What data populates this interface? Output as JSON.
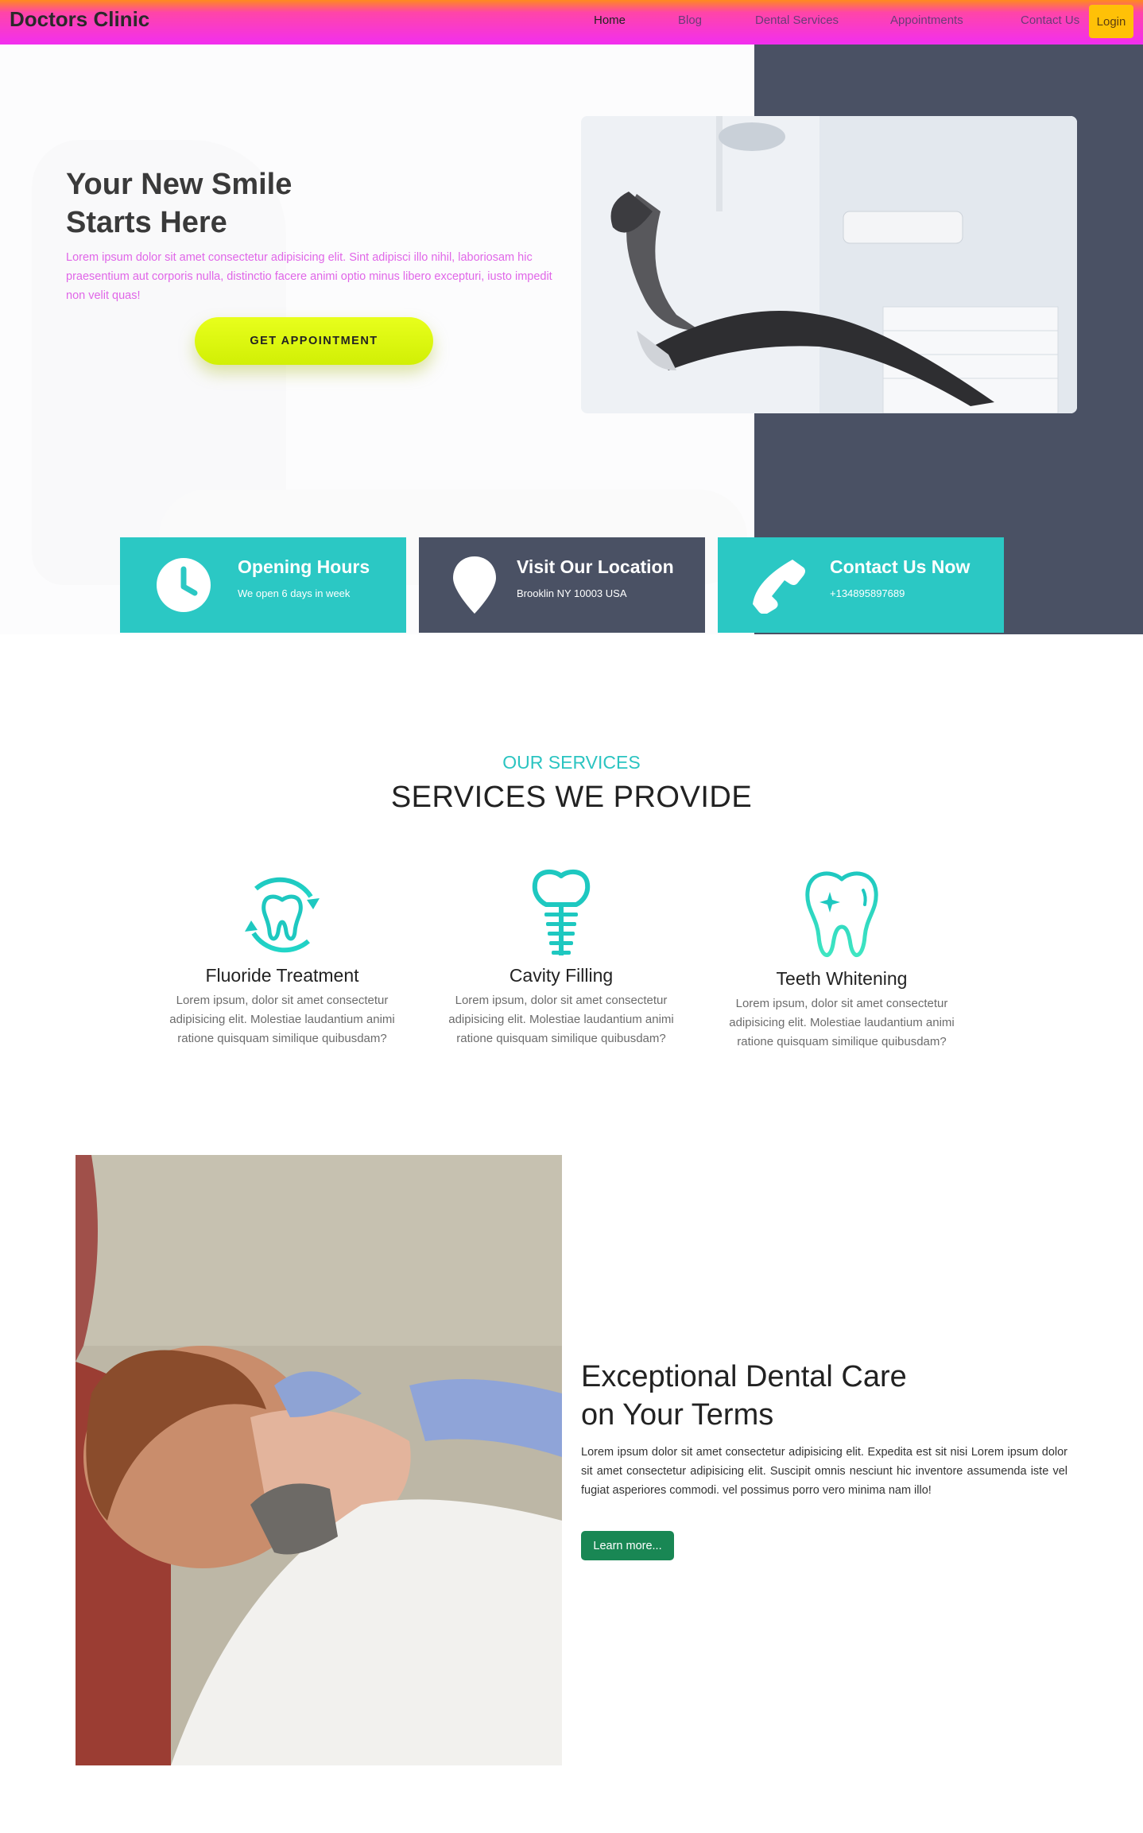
{
  "navbar": {
    "brand": "Doctors Clinic",
    "links": [
      "Home",
      "Blog",
      "Dental Services",
      "Appointments",
      "Contact Us"
    ],
    "login": "Login"
  },
  "hero": {
    "title": "Your New Smile\nStarts Here",
    "text": "Lorem ipsum dolor sit amet consectetur adipisicing elit. Sint adipisci illo nihil, laboriosam hic praesentium aut corporis nulla, distinctio facere animi optio minus libero excepturi, iusto impedit non velit quas!",
    "button": "GET APPOINTMENT"
  },
  "cards": [
    {
      "title": "Opening Hours",
      "text": "We open 6 days in week",
      "icon": "clock-icon",
      "color": "#2bc8c4"
    },
    {
      "title": "Visit Our Location",
      "text": "Brooklin NY 10003 USA",
      "icon": "location-pin-icon",
      "color": "#4a5164"
    },
    {
      "title": "Contact Us Now",
      "text": "+134895897689",
      "icon": "phone-icon",
      "color": "#2bc8c4"
    }
  ],
  "services": {
    "eyebrow": "OUR SERVICES",
    "heading": "SERVICES WE PROVIDE",
    "items": [
      {
        "title": "Fluoride Treatment",
        "text": "Lorem ipsum, dolor sit amet consectetur adipisicing elit. Molestiae laudantium animi ratione quisquam similique quibusdam?",
        "icon": "tooth-refresh-icon"
      },
      {
        "title": "Cavity Filling",
        "text": "Lorem ipsum, dolor sit amet consectetur adipisicing elit. Molestiae laudantium animi ratione quisquam similique quibusdam?",
        "icon": "dental-implant-icon"
      },
      {
        "title": "Teeth Whitening",
        "text": "Lorem ipsum, dolor sit amet consectetur adipisicing elit. Molestiae laudantium animi ratione quisquam similique quibusdam?",
        "icon": "tooth-sparkle-icon"
      }
    ]
  },
  "about": {
    "title": "Exceptional Dental Care\non Your Terms",
    "text": "Lorem ipsum dolor sit amet consectetur adipisicing elit. Expedita est sit nisi Lorem ipsum dolor sit amet consectetur adipisicing elit. Suscipit omnis nesciunt hic inventore assumenda iste vel fugiat asperiores commodi. vel possimus porro vero minima nam illo!",
    "button": "Learn more..."
  },
  "colors": {
    "accent_teal": "#2bc8c4",
    "dark_slate": "#4a5164",
    "button_lime": "#dff812",
    "login_yellow": "#ffc107",
    "learn_green": "#198754",
    "hero_text_pink": "#e066e8"
  }
}
